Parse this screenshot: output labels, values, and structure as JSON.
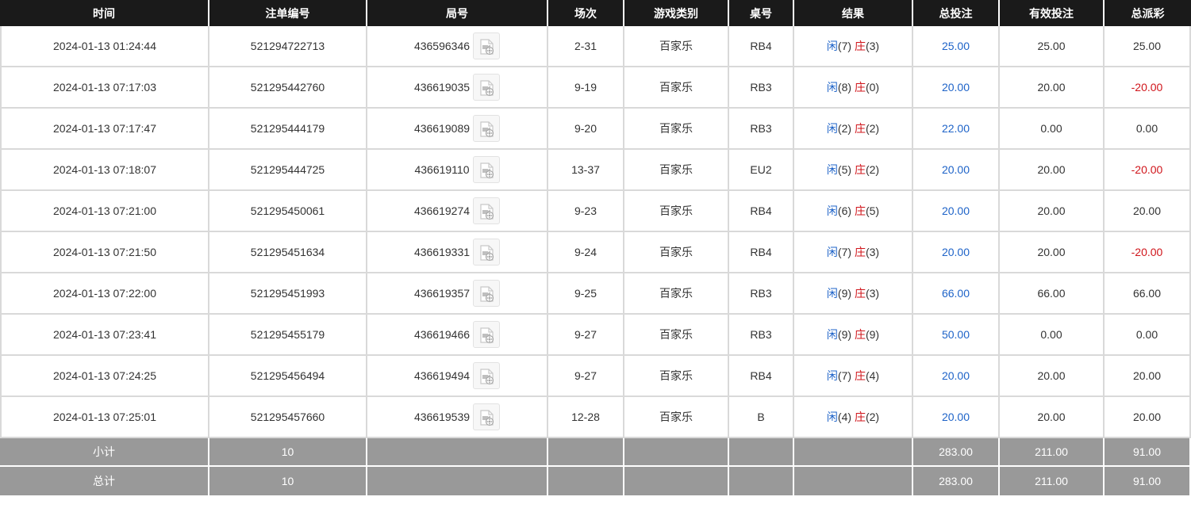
{
  "headers": {
    "time": "时间",
    "order_no": "注单编号",
    "round_no": "局号",
    "shoe": "场次",
    "game_type": "游戏类别",
    "table_no": "桌号",
    "result": "结果",
    "total_bet": "总投注",
    "valid_bet": "有效投注",
    "payout": "总派彩"
  },
  "rows": [
    {
      "time": "2024-01-13 01:24:44",
      "order": "521294722713",
      "round": "436596346",
      "shoe": "2-31",
      "game": "百家乐",
      "table": "RB4",
      "p_label": "闲",
      "p_val": "(7)",
      "b_label": "庄",
      "b_val": "(3)",
      "total": "25.00",
      "valid": "25.00",
      "payout": "25.00",
      "payout_color": "#333333"
    },
    {
      "time": "2024-01-13 07:17:03",
      "order": "521295442760",
      "round": "436619035",
      "shoe": "9-19",
      "game": "百家乐",
      "table": "RB3",
      "p_label": "闲",
      "p_val": "(8)",
      "b_label": "庄",
      "b_val": "(0)",
      "total": "20.00",
      "valid": "20.00",
      "payout": "-20.00",
      "payout_color": "#d0151b"
    },
    {
      "time": "2024-01-13 07:17:47",
      "order": "521295444179",
      "round": "436619089",
      "shoe": "9-20",
      "game": "百家乐",
      "table": "RB3",
      "p_label": "闲",
      "p_val": "(2)",
      "b_label": "庄",
      "b_val": "(2)",
      "total": "22.00",
      "valid": "0.00",
      "payout": "0.00",
      "payout_color": "#333333"
    },
    {
      "time": "2024-01-13 07:18:07",
      "order": "521295444725",
      "round": "436619110",
      "shoe": "13-37",
      "game": "百家乐",
      "table": "EU2",
      "p_label": "闲",
      "p_val": "(5)",
      "b_label": "庄",
      "b_val": "(2)",
      "total": "20.00",
      "valid": "20.00",
      "payout": "-20.00",
      "payout_color": "#d0151b"
    },
    {
      "time": "2024-01-13 07:21:00",
      "order": "521295450061",
      "round": "436619274",
      "shoe": "9-23",
      "game": "百家乐",
      "table": "RB4",
      "p_label": "闲",
      "p_val": "(6)",
      "b_label": "庄",
      "b_val": "(5)",
      "total": "20.00",
      "valid": "20.00",
      "payout": "20.00",
      "payout_color": "#333333"
    },
    {
      "time": "2024-01-13 07:21:50",
      "order": "521295451634",
      "round": "436619331",
      "shoe": "9-24",
      "game": "百家乐",
      "table": "RB4",
      "p_label": "闲",
      "p_val": "(7)",
      "b_label": "庄",
      "b_val": "(3)",
      "total": "20.00",
      "valid": "20.00",
      "payout": "-20.00",
      "payout_color": "#d0151b"
    },
    {
      "time": "2024-01-13 07:22:00",
      "order": "521295451993",
      "round": "436619357",
      "shoe": "9-25",
      "game": "百家乐",
      "table": "RB3",
      "p_label": "闲",
      "p_val": "(9)",
      "b_label": "庄",
      "b_val": "(3)",
      "total": "66.00",
      "valid": "66.00",
      "payout": "66.00",
      "payout_color": "#333333"
    },
    {
      "time": "2024-01-13 07:23:41",
      "order": "521295455179",
      "round": "436619466",
      "shoe": "9-27",
      "game": "百家乐",
      "table": "RB3",
      "p_label": "闲",
      "p_val": "(9)",
      "b_label": "庄",
      "b_val": "(9)",
      "total": "50.00",
      "valid": "0.00",
      "payout": "0.00",
      "payout_color": "#333333"
    },
    {
      "time": "2024-01-13 07:24:25",
      "order": "521295456494",
      "round": "436619494",
      "shoe": "9-27",
      "game": "百家乐",
      "table": "RB4",
      "p_label": "闲",
      "p_val": "(7)",
      "b_label": "庄",
      "b_val": "(4)",
      "total": "20.00",
      "valid": "20.00",
      "payout": "20.00",
      "payout_color": "#333333"
    },
    {
      "time": "2024-01-13 07:25:01",
      "order": "521295457660",
      "round": "436619539",
      "shoe": "12-28",
      "game": "百家乐",
      "table": "B",
      "p_label": "闲",
      "p_val": "(4)",
      "b_label": "庄",
      "b_val": "(2)",
      "total": "20.00",
      "valid": "20.00",
      "payout": "20.00",
      "payout_color": "#333333"
    }
  ],
  "subtotal": {
    "label": "小计",
    "count": "10",
    "total": "283.00",
    "valid": "211.00",
    "payout": "91.00"
  },
  "grand_total": {
    "label": "总计",
    "count": "10",
    "total": "283.00",
    "valid": "211.00",
    "payout": "91.00"
  },
  "icons": {
    "replay": "video-replay-icon"
  }
}
